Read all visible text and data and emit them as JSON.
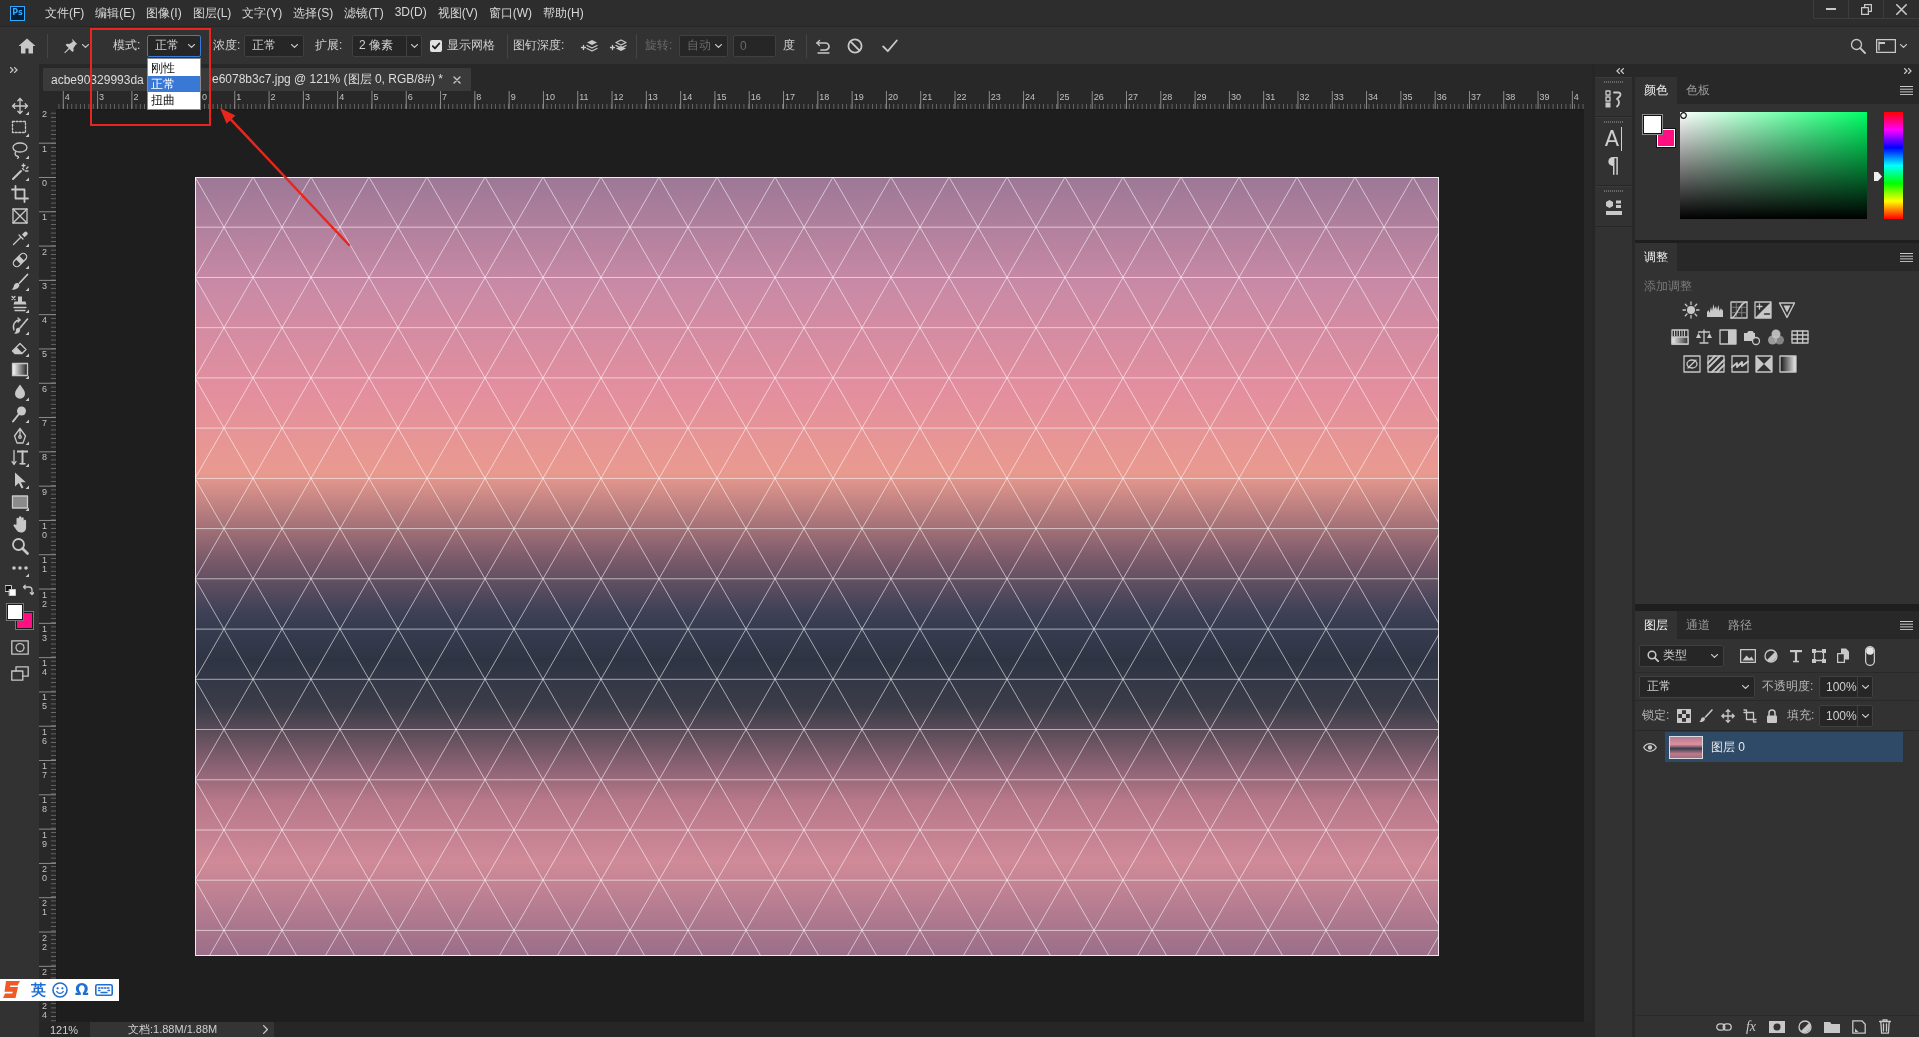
{
  "menu_bar": {
    "logo": "Ps",
    "items": [
      "文件(F)",
      "编辑(E)",
      "图像(I)",
      "图层(L)",
      "文字(Y)",
      "选择(S)",
      "滤镜(T)",
      "3D(D)",
      "视图(V)",
      "窗口(W)",
      "帮助(H)"
    ]
  },
  "options_bar": {
    "mode": {
      "label": "模式:",
      "value": "正常",
      "expanded": true,
      "options": [
        {
          "label": "刚性",
          "selected": false
        },
        {
          "label": "正常",
          "selected": true
        },
        {
          "label": "扭曲",
          "selected": false
        }
      ]
    },
    "density": {
      "label": "浓度:",
      "value": "正常"
    },
    "expansion": {
      "label": "扩展:",
      "value": "2 像素"
    },
    "show_mesh": {
      "label": "显示网格",
      "checked": true
    },
    "pin_depth": {
      "label": "图钉深度:"
    },
    "rotate": {
      "label": "旋转:",
      "value": "自动",
      "angle": "0",
      "unit": "度",
      "disabled": true
    }
  },
  "toolbar": {
    "swatches": [
      {
        "color": "#ffffff"
      },
      {
        "color": "#ff0f82"
      }
    ]
  },
  "document": {
    "tab": {
      "title_start": "acbe90329993da",
      "title_end": "e6078b3c7.jpg @ 121% (图层 0, RGB/8#) *"
    },
    "ruler_top": {
      "left_labels": [
        "4",
        "3",
        "2"
      ],
      "right_labels": [
        "0",
        "1",
        "2",
        "3",
        "4",
        "5",
        "6",
        "7",
        "8",
        "9",
        "10",
        "11",
        "12",
        "13",
        "14",
        "15",
        "16",
        "17",
        "18",
        "19",
        "20",
        "21",
        "22",
        "23",
        "24",
        "25",
        "26",
        "27",
        "28",
        "29",
        "30",
        "31",
        "32",
        "33",
        "34",
        "35",
        "36",
        "37",
        "38",
        "39",
        "4"
      ]
    },
    "ruler_left": {
      "labels": [
        "2",
        "1",
        "0",
        "1",
        "2",
        "3",
        "4",
        "5",
        "6",
        "7",
        "8",
        "9",
        "10",
        "11",
        "12",
        "13",
        "14",
        "15",
        "16",
        "17",
        "18",
        "19",
        "20",
        "21",
        "22",
        "2",
        "24"
      ]
    }
  },
  "status_bar": {
    "zoom": "121%",
    "doc_info": "文档:1.88M/1.88M"
  },
  "dock": {
    "glyphs": [
      "A",
      "¶"
    ]
  },
  "color_panel": {
    "tabs": [
      {
        "label": "颜色",
        "selected": true
      },
      {
        "label": "色板",
        "selected": false
      }
    ],
    "swatches": [
      {
        "color": "#ffffff"
      },
      {
        "color": "#ff0f82"
      }
    ],
    "hue_slider": {
      "level": 0.4
    }
  },
  "adjustments_panel": {
    "tabs": [
      {
        "label": "调整",
        "selected": true
      }
    ],
    "hint": "添加调整"
  },
  "layers_panel": {
    "tabs": [
      {
        "label": "图层",
        "selected": true
      },
      {
        "label": "通道",
        "selected": false
      },
      {
        "label": "路径",
        "selected": false
      }
    ],
    "filter": "类型",
    "blend_mode": "正常",
    "opacity": {
      "label": "不透明度:",
      "value": "100%"
    },
    "lock": {
      "label": "锁定:"
    },
    "fill": {
      "label": "填充:",
      "value": "100%"
    },
    "layers": [
      {
        "name": "图层 0",
        "visible": true,
        "selected": true
      }
    ],
    "fx": "fx"
  },
  "ime_bar": {
    "mode": "英",
    "symbol": "Ω"
  }
}
